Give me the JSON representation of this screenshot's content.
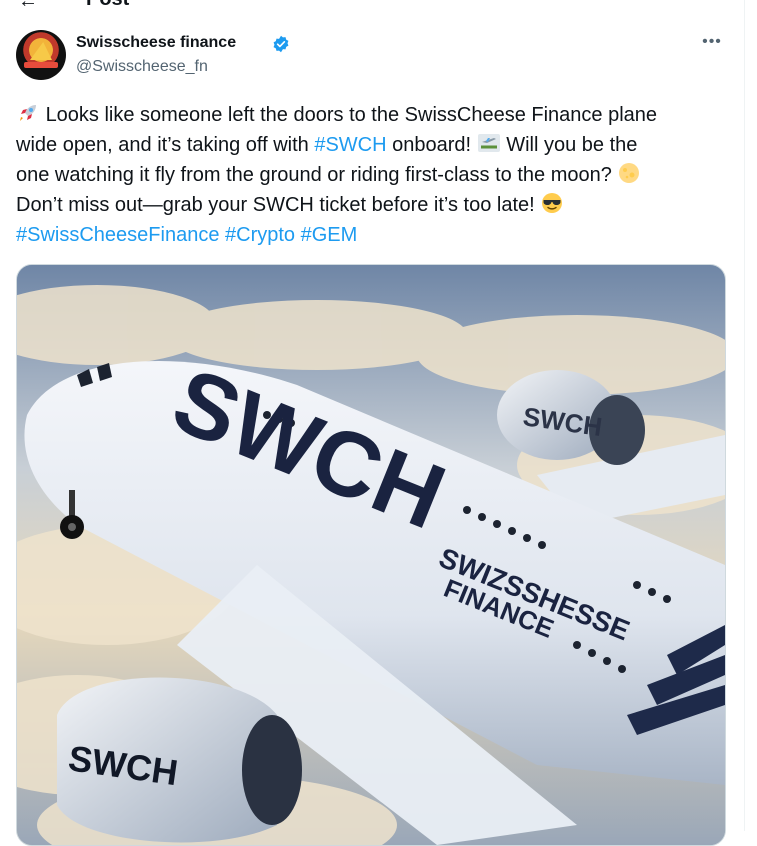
{
  "header": {
    "title": "Post"
  },
  "author": {
    "display_name": "Swisscheese finance",
    "handle": "@Swisscheese_fn"
  },
  "tweet": {
    "line1_a": "Looks like someone left the doors to the SwissCheese Finance plane",
    "line2_a": "wide open, and it’s taking off with ",
    "line2_tag": "#SWCH",
    "line2_b": " onboard! ",
    "line2_c": " Will you be the",
    "line3_a": "one watching it fly from the ground or riding first-class to the moon? ",
    "line4_a": "Don’t miss out—grab your SWCH ticket before it’s too late! ",
    "tag1": "#SwissCheeseFinance",
    "tag2": "#Crypto",
    "tag3": "#GEM"
  },
  "media": {
    "fuselage_text": "SWCH",
    "side_text_1": "SWIZSSHESSE",
    "side_text_2": "FINANCE",
    "engine_text": "SWCH"
  },
  "colors": {
    "link": "#1d9bf0",
    "text": "#0f1419",
    "muted": "#536471",
    "verified": "#1d9bf0"
  },
  "icons": {
    "rocket": "rocket-icon",
    "airplane": "airplane-icon",
    "moon": "moon-icon",
    "sunglasses": "sunglasses-icon",
    "verified": "verified-badge-icon",
    "more": "more-icon"
  }
}
